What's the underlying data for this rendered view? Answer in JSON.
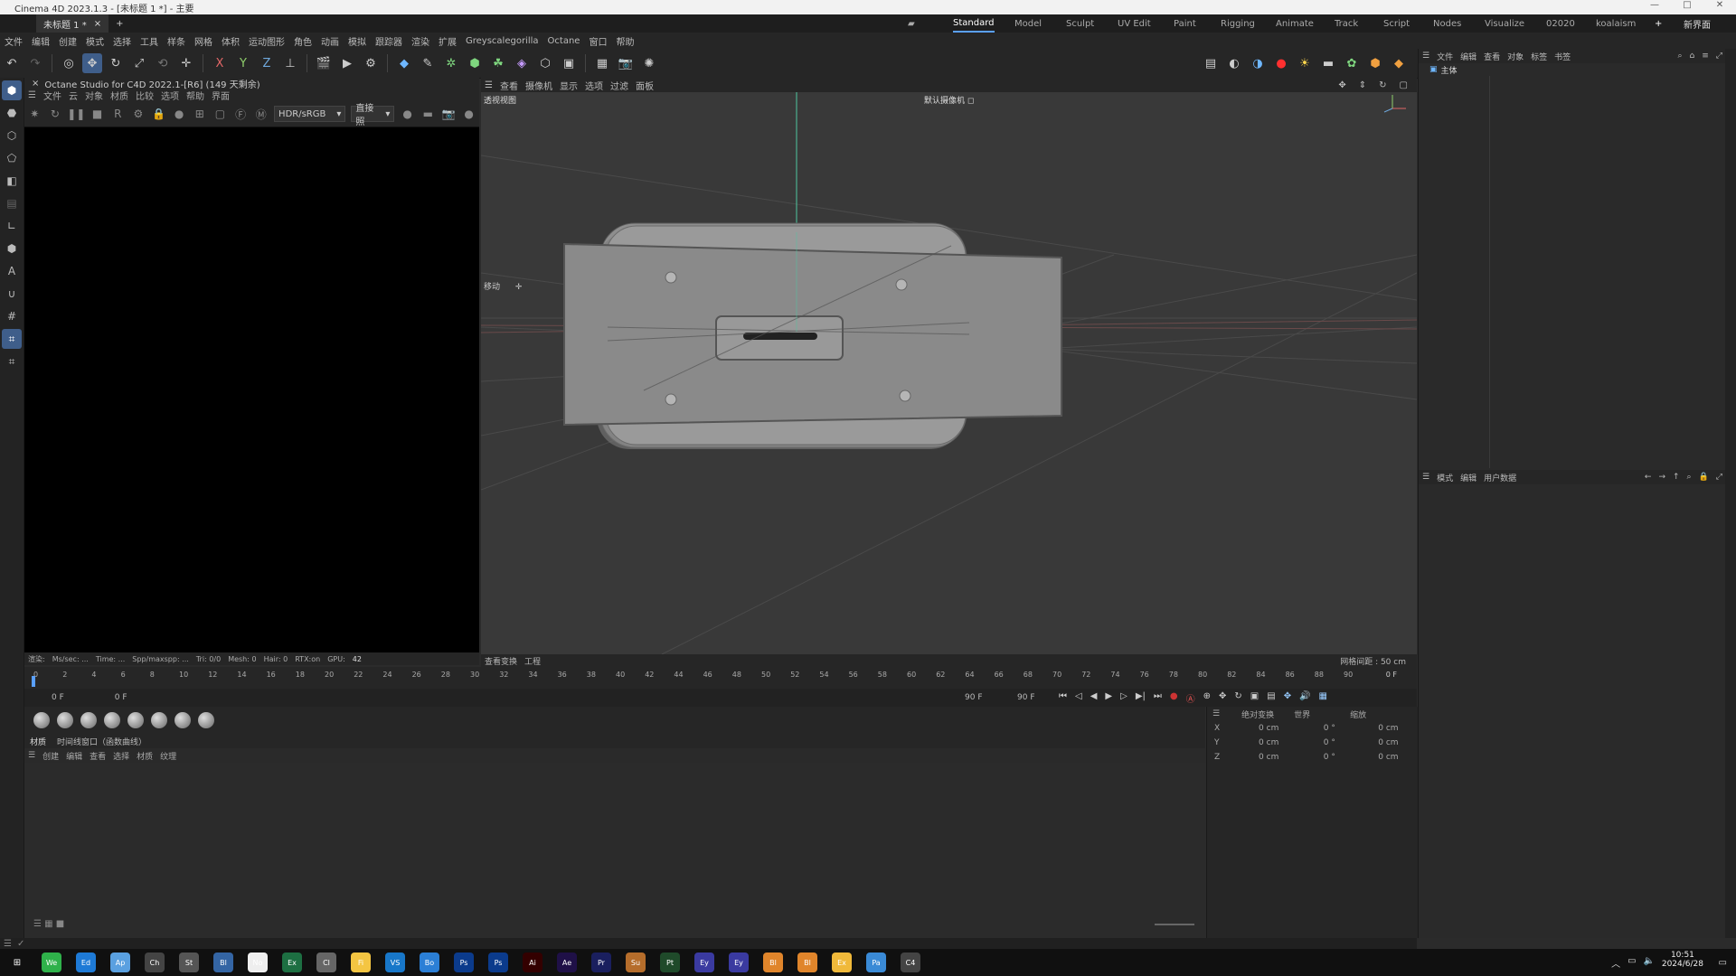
{
  "window": {
    "title": "Cinema 4D 2023.1.3 - [未标题 1 *] - 主要",
    "controls": [
      "—",
      "□",
      "✕"
    ]
  },
  "doc_tab": "未标题 1 *",
  "layouts": [
    "Standard",
    "Model",
    "Sculpt",
    "UV Edit",
    "Paint",
    "Rigging",
    "Animate",
    "Track",
    "Script",
    "Nodes",
    "Visualize",
    "02020",
    "koalaism"
  ],
  "layout_right": "新界面",
  "menu": [
    "文件",
    "编辑",
    "创建",
    "模式",
    "选择",
    "工具",
    "样条",
    "网格",
    "体积",
    "运动图形",
    "角色",
    "动画",
    "模拟",
    "跟踪器",
    "渲染",
    "扩展",
    "Greyscalegorilla",
    "Octane",
    "窗口",
    "帮助"
  ],
  "octane": {
    "title": "Octane Studio for C4D 2022.1-[R6] (149 天剩余)",
    "menu": [
      "文件",
      "云",
      "对象",
      "材质",
      "比较",
      "选项",
      "帮助",
      "界面"
    ],
    "dropdown1": "HDR/sRGB",
    "dropdown2": "直接照",
    "status": [
      "渲染:",
      "Ms/sec: ...",
      "Time: ...",
      "Spp/maxspp: ...",
      "Tri: 0/0",
      "Mesh: 0",
      "Hair: 0",
      "RTX:on",
      "GPU:",
      "42"
    ]
  },
  "viewport": {
    "menu": [
      "查看",
      "摄像机",
      "显示",
      "选项",
      "过滤",
      "面板"
    ],
    "name": "透视视图",
    "camera": "默认摄像机",
    "move_label": "移动",
    "status_left": [
      "查看变换",
      "工程"
    ],
    "grid": "网格间距 : 50 cm"
  },
  "object_panel": {
    "menu": [
      "文件",
      "编辑",
      "查看",
      "对象",
      "标签",
      "书签"
    ],
    "root": "主体"
  },
  "attr_panel": {
    "menu": [
      "模式",
      "编辑",
      "用户数据"
    ]
  },
  "timeline": {
    "ticks": [
      "0",
      "2",
      "4",
      "6",
      "8",
      "10",
      "12",
      "14",
      "16",
      "18",
      "20",
      "22",
      "24",
      "26",
      "28",
      "30",
      "32",
      "34",
      "36",
      "38",
      "40",
      "42",
      "44",
      "46",
      "48",
      "50",
      "52",
      "54",
      "56",
      "58",
      "60",
      "62",
      "64",
      "66",
      "68",
      "70",
      "72",
      "74",
      "76",
      "78",
      "80",
      "82",
      "84",
      "86",
      "88",
      "90"
    ],
    "frame_right": "0 F",
    "start": "0 F",
    "start2": "0 F",
    "end": "90 F",
    "end2": "90 F"
  },
  "materials": {
    "tabs": [
      "材质",
      "时间线窗口（函数曲线）"
    ],
    "menu": [
      "创建",
      "编辑",
      "查看",
      "选择",
      "材质",
      "纹理"
    ]
  },
  "coords": {
    "headers": [
      "绝对变换",
      "世界",
      "缩放"
    ],
    "rows": [
      {
        "axis": "X",
        "pos": "0 cm",
        "rot": "0 °",
        "size": "0 cm"
      },
      {
        "axis": "Y",
        "pos": "0 cm",
        "rot": "0 °",
        "size": "0 cm"
      },
      {
        "axis": "Z",
        "pos": "0 cm",
        "rot": "0 °",
        "size": "0 cm"
      }
    ]
  },
  "taskbar": {
    "time": "10:51",
    "date": "2024/6/28",
    "apps": [
      "WeChat",
      "Edge",
      "App",
      "Chrome",
      "Steam",
      "Blender",
      "Notepad",
      "Excel",
      "Clock",
      "Files",
      "VSCode",
      "Box",
      "Ps",
      "Ps",
      "Ai",
      "Ae",
      "Pr",
      "Sub",
      "Pt",
      "Eye",
      "Eye2",
      "Blend",
      "Blend2",
      "Explorer",
      "Paint",
      "C4D"
    ]
  }
}
